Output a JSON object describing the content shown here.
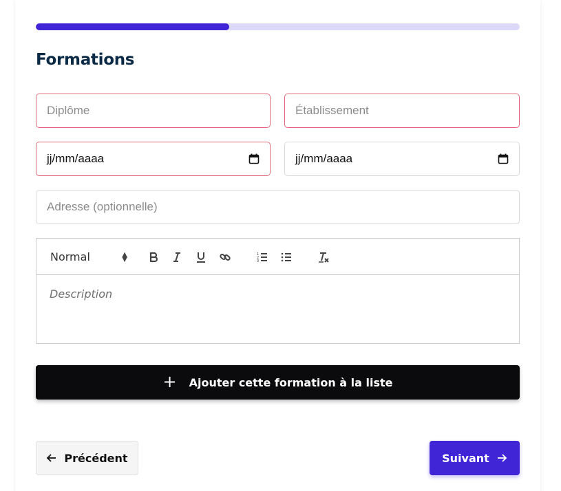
{
  "progress": {
    "fraction": 0.4,
    "fill_color": "#3f25d6",
    "track_color": "#dcd8f8"
  },
  "page_title": "Formations",
  "fields": {
    "diplome": {
      "placeholder": "Diplôme",
      "error": true
    },
    "etablissement": {
      "placeholder": "Établissement",
      "error": true
    },
    "date_debut": {
      "value": "jj/mm/aaaa",
      "error": true,
      "icon": "calendar-icon"
    },
    "date_fin": {
      "value": "jj/mm/aaaa",
      "error": false,
      "icon": "calendar-icon"
    },
    "adresse": {
      "placeholder": "Adresse (optionnelle)"
    }
  },
  "editor": {
    "heading_select": "Normal",
    "toolbar_icons": [
      "bold-icon",
      "italic-icon",
      "underline-icon",
      "link-icon",
      "ordered-list-icon",
      "bullet-list-icon",
      "clear-format-icon"
    ],
    "placeholder": "Description"
  },
  "actions": {
    "add_label": "Ajouter cette formation à la liste",
    "add_icon": "plus-icon",
    "prev_label": "Précédent",
    "prev_icon": "arrow-left-icon",
    "next_label": "Suivant",
    "next_icon": "arrow-right-icon"
  },
  "colors": {
    "primary": "#3f25d6",
    "error_border": "#e06a7c",
    "title": "#0b2a45"
  }
}
